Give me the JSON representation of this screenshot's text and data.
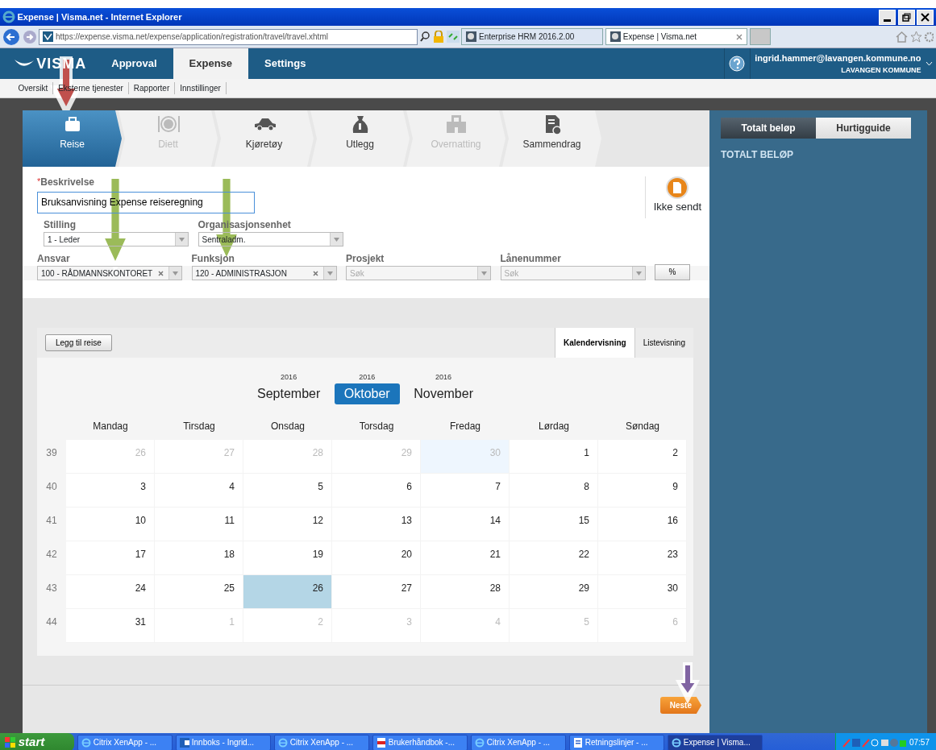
{
  "window": {
    "title": "Expense | Visma.net - Internet Explorer"
  },
  "browser": {
    "url": "https://expense.visma.net/expense/application/registration/travel/travel.xhtml",
    "tabs": [
      {
        "label": "Enterprise HRM 2016.2.00",
        "selected": false
      },
      {
        "label": "Expense | Visma.net",
        "selected": true
      }
    ]
  },
  "app_header": {
    "logo": "VISMA",
    "nav": [
      {
        "label": "Approval",
        "selected": false
      },
      {
        "label": "Expense",
        "selected": true
      },
      {
        "label": "Settings",
        "selected": false
      }
    ],
    "user_email": "ingrid.hammer@lavangen.kommune.no",
    "organisation": "LAVANGEN KOMMUNE"
  },
  "subnav": [
    "Oversikt",
    "Eksterne tjenester",
    "Rapporter",
    "Innstillinger"
  ],
  "steps": [
    {
      "label": "Reise",
      "kind": "suitcase",
      "selected": true,
      "disabled": false
    },
    {
      "label": "Diett",
      "kind": "plate",
      "selected": false,
      "disabled": true
    },
    {
      "label": "Kjøretøy",
      "kind": "car",
      "selected": false,
      "disabled": false
    },
    {
      "label": "Utlegg",
      "kind": "moneybag",
      "selected": false,
      "disabled": false
    },
    {
      "label": "Overnatting",
      "kind": "hotel",
      "selected": false,
      "disabled": true
    },
    {
      "label": "Sammendrag",
      "kind": "report",
      "selected": false,
      "disabled": false
    }
  ],
  "form": {
    "description": {
      "required": true,
      "required_mark": "*",
      "label": "Beskrivelse",
      "value": "Bruksanvisning Expense reiseregning"
    },
    "status": "Ikke sendt",
    "row_1": [
      {
        "label": "Stilling",
        "value": "1 - Leder",
        "clearable": false
      },
      {
        "label": "Organisasjonsenhet",
        "value": "Sentraladm.",
        "clearable": false
      }
    ],
    "row_2": [
      {
        "label": "Ansvar",
        "value": "100 - RÅDMANNSKONTORET",
        "clearable": true
      },
      {
        "label": "Funksjon",
        "value": "120 - ADMINISTRASJON",
        "clearable": true
      },
      {
        "label": "Prosjekt",
        "placeholder": "Søk",
        "clearable": false
      },
      {
        "label": "Lånenummer",
        "placeholder": "Søk",
        "clearable": false
      }
    ],
    "percent_button": "%"
  },
  "calendar": {
    "add_button": "Legg til reise",
    "views": [
      {
        "label": "Kalendervisning",
        "selected": true
      },
      {
        "label": "Listevisning",
        "selected": false
      }
    ],
    "months": [
      {
        "year": "2016",
        "name": "September",
        "selected": false
      },
      {
        "year": "2016",
        "name": "Oktober",
        "selected": true
      },
      {
        "year": "2016",
        "name": "November",
        "selected": false
      }
    ],
    "weekdays": [
      "Mandag",
      "Tirsdag",
      "Onsdag",
      "Torsdag",
      "Fredag",
      "Lørdag",
      "Søndag"
    ],
    "weeks": [
      {
        "number": "39",
        "days": [
          {
            "day": "26",
            "outside": true,
            "selected": false,
            "highlighted": false
          },
          {
            "day": "27",
            "outside": true,
            "selected": false,
            "highlighted": false
          },
          {
            "day": "28",
            "outside": true,
            "selected": false,
            "highlighted": false
          },
          {
            "day": "29",
            "outside": true,
            "selected": false,
            "highlighted": false
          },
          {
            "day": "30",
            "outside": true,
            "selected": false,
            "highlighted": true
          },
          {
            "day": "1",
            "outside": false,
            "selected": false,
            "highlighted": false
          },
          {
            "day": "2",
            "outside": false,
            "selected": false,
            "highlighted": false
          }
        ]
      },
      {
        "number": "40",
        "days": [
          {
            "day": "3",
            "outside": false,
            "selected": false,
            "highlighted": false
          },
          {
            "day": "4",
            "outside": false,
            "selected": false,
            "highlighted": false
          },
          {
            "day": "5",
            "outside": false,
            "selected": false,
            "highlighted": false
          },
          {
            "day": "6",
            "outside": false,
            "selected": false,
            "highlighted": false
          },
          {
            "day": "7",
            "outside": false,
            "selected": false,
            "highlighted": false
          },
          {
            "day": "8",
            "outside": false,
            "selected": false,
            "highlighted": false
          },
          {
            "day": "9",
            "outside": false,
            "selected": false,
            "highlighted": false
          }
        ]
      },
      {
        "number": "41",
        "days": [
          {
            "day": "10",
            "outside": false,
            "selected": false,
            "highlighted": false
          },
          {
            "day": "11",
            "outside": false,
            "selected": false,
            "highlighted": false
          },
          {
            "day": "12",
            "outside": false,
            "selected": false,
            "highlighted": false
          },
          {
            "day": "13",
            "outside": false,
            "selected": false,
            "highlighted": false
          },
          {
            "day": "14",
            "outside": false,
            "selected": false,
            "highlighted": false
          },
          {
            "day": "15",
            "outside": false,
            "selected": false,
            "highlighted": false
          },
          {
            "day": "16",
            "outside": false,
            "selected": false,
            "highlighted": false
          }
        ]
      },
      {
        "number": "42",
        "days": [
          {
            "day": "17",
            "outside": false,
            "selected": false,
            "highlighted": false
          },
          {
            "day": "18",
            "outside": false,
            "selected": false,
            "highlighted": false
          },
          {
            "day": "19",
            "outside": false,
            "selected": false,
            "highlighted": false
          },
          {
            "day": "20",
            "outside": false,
            "selected": false,
            "highlighted": false
          },
          {
            "day": "21",
            "outside": false,
            "selected": false,
            "highlighted": false
          },
          {
            "day": "22",
            "outside": false,
            "selected": false,
            "highlighted": false
          },
          {
            "day": "23",
            "outside": false,
            "selected": false,
            "highlighted": false
          }
        ]
      },
      {
        "number": "43",
        "days": [
          {
            "day": "24",
            "outside": false,
            "selected": false,
            "highlighted": false
          },
          {
            "day": "25",
            "outside": false,
            "selected": false,
            "highlighted": false
          },
          {
            "day": "26",
            "outside": false,
            "selected": true,
            "highlighted": false
          },
          {
            "day": "27",
            "outside": false,
            "selected": false,
            "highlighted": false
          },
          {
            "day": "28",
            "outside": false,
            "selected": false,
            "highlighted": false
          },
          {
            "day": "29",
            "outside": false,
            "selected": false,
            "highlighted": false
          },
          {
            "day": "30",
            "outside": false,
            "selected": false,
            "highlighted": false
          }
        ]
      },
      {
        "number": "44",
        "days": [
          {
            "day": "31",
            "outside": false,
            "selected": false,
            "highlighted": false
          },
          {
            "day": "1",
            "outside": true,
            "selected": false,
            "highlighted": false
          },
          {
            "day": "2",
            "outside": true,
            "selected": false,
            "highlighted": false
          },
          {
            "day": "3",
            "outside": true,
            "selected": false,
            "highlighted": false
          },
          {
            "day": "4",
            "outside": true,
            "selected": false,
            "highlighted": false
          },
          {
            "day": "5",
            "outside": true,
            "selected": false,
            "highlighted": false
          },
          {
            "day": "6",
            "outside": true,
            "selected": false,
            "highlighted": false
          }
        ]
      }
    ]
  },
  "next_button": "Neste",
  "side_panel": {
    "tabs": [
      {
        "label": "Totalt beløp",
        "selected": true
      },
      {
        "label": "Hurtigguide",
        "selected": false
      }
    ],
    "heading": "TOTALT BELØP"
  },
  "taskbar": {
    "start": "start",
    "items": [
      {
        "label": "Citrix XenApp - ...",
        "kind": "ie",
        "selected": false
      },
      {
        "label": "Innboks - Ingrid...",
        "kind": "mail",
        "selected": false
      },
      {
        "label": "Citrix XenApp - ...",
        "kind": "ie",
        "selected": false
      },
      {
        "label": "Brukerhåndbok -...",
        "kind": "pdf",
        "selected": false
      },
      {
        "label": "Citrix XenApp - ...",
        "kind": "ie",
        "selected": false
      },
      {
        "label": "Retningslinjer - ...",
        "kind": "doc",
        "selected": false
      },
      {
        "label": "Expense | Visma...",
        "kind": "ie",
        "selected": true
      }
    ],
    "clock": "07:57"
  },
  "annotations": [
    {
      "color": "#c0504d"
    },
    {
      "color": "#9bbb59"
    },
    {
      "color": "#9bbb59"
    },
    {
      "color": "#8064a2"
    }
  ]
}
